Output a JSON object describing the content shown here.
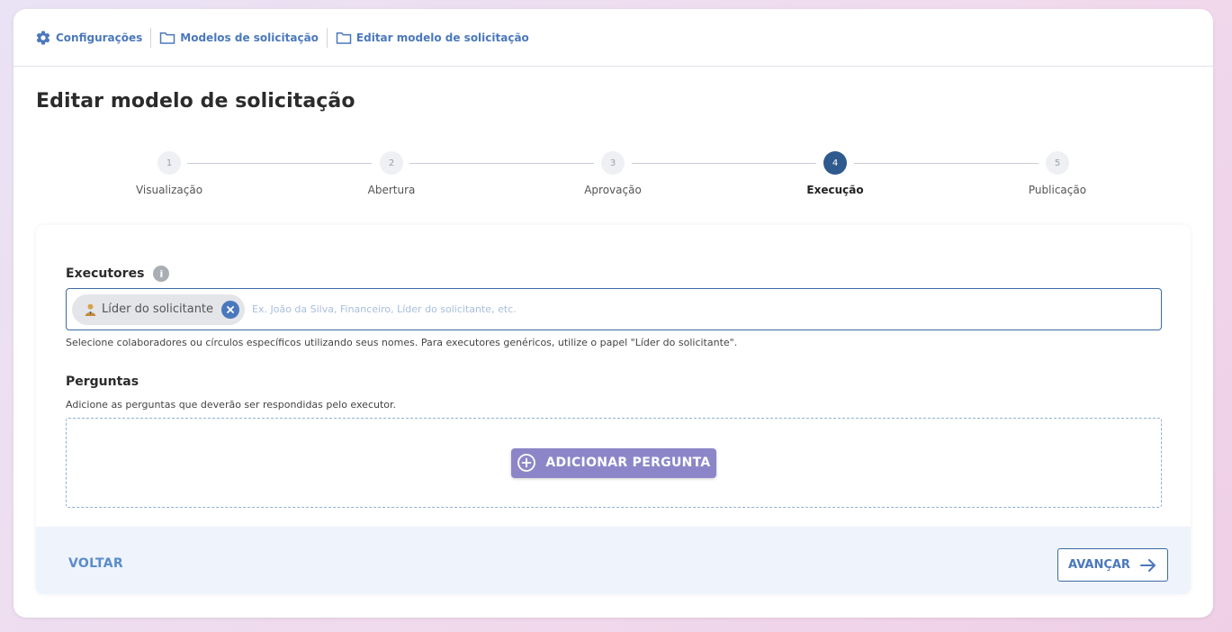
{
  "breadcrumb": [
    {
      "label": "Configurações",
      "icon": "gear-icon"
    },
    {
      "label": "Modelos de solicitação",
      "icon": "folder-icon"
    },
    {
      "label": "Editar modelo de solicitação",
      "icon": "folder-icon"
    }
  ],
  "page_title": "Editar modelo de solicitação",
  "stepper": {
    "active_step": 4,
    "steps": [
      {
        "number": "1",
        "label": "Visualização"
      },
      {
        "number": "2",
        "label": "Abertura"
      },
      {
        "number": "3",
        "label": "Aprovação"
      },
      {
        "number": "4",
        "label": "Execução"
      },
      {
        "number": "5",
        "label": "Publicação"
      }
    ]
  },
  "executors": {
    "label": "Executores",
    "info_glyph": "i",
    "chips": [
      {
        "label": "Líder do solicitante",
        "icon": "person-icon"
      }
    ],
    "placeholder": "Ex. João da Silva, Financeiro, Líder do solicitante, etc.",
    "helper": "Selecione colaboradores ou círculos específicos utilizando seus nomes. Para executores genéricos, utilize o papel \"Líder do solicitante\"."
  },
  "questions": {
    "label": "Perguntas",
    "helper": "Adicione as perguntas que deverão ser respondidas pelo executor.",
    "add_button_label": "ADICIONAR PERGUNTA"
  },
  "footer": {
    "back_label": "VOLTAR",
    "next_label": "AVANÇAR"
  },
  "colors": {
    "primary": "#4a78bd",
    "active_step": "#2f5a8e",
    "add_button": "#8c86c9",
    "footer_bg": "#eef3fc"
  }
}
